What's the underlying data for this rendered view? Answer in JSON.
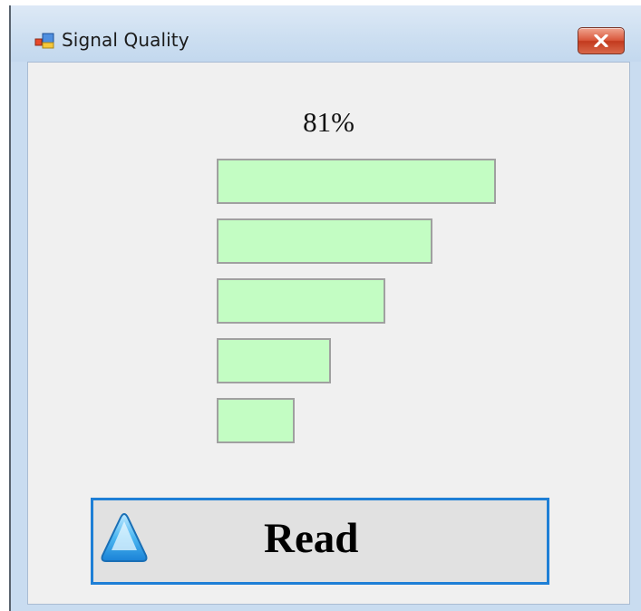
{
  "window": {
    "title": "Signal Quality",
    "icon": "app-window-icon",
    "close_icon": "close-icon"
  },
  "signal": {
    "quality_label": "81%",
    "quality_percent": 81,
    "bar_count": 5,
    "bar_color": "#c3fdc3",
    "bar_fill_levels": [
      1.0,
      0.8,
      0.6,
      0.4,
      0.2
    ]
  },
  "read_button": {
    "label": "Read",
    "icon": "triangle-up-icon",
    "border_color": "#1e7fd6"
  }
}
